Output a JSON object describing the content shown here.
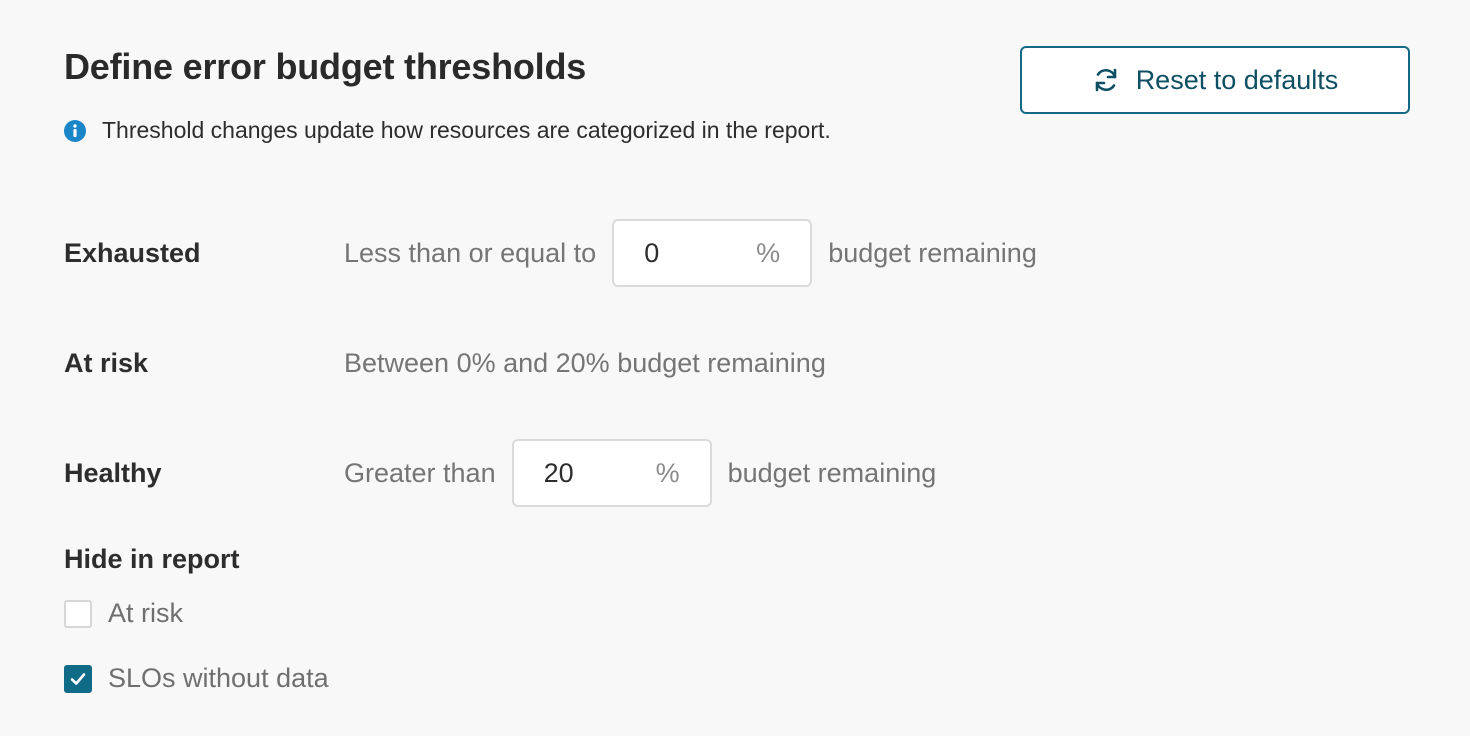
{
  "header": {
    "title": "Define error budget thresholds",
    "info_text": "Threshold changes update how resources are categorized in the report.",
    "reset_label": "Reset to defaults"
  },
  "thresholds": {
    "exhausted": {
      "label": "Exhausted",
      "prefix": "Less than or equal to",
      "value": "0",
      "unit": "%",
      "suffix": "budget remaining"
    },
    "at_risk": {
      "label": "At risk",
      "description": "Between 0% and 20% budget remaining"
    },
    "healthy": {
      "label": "Healthy",
      "prefix": "Greater than",
      "value": "20",
      "unit": "%",
      "suffix": "budget remaining"
    }
  },
  "hide_in_report": {
    "title": "Hide in report",
    "options": [
      {
        "label": "At risk",
        "checked": false
      },
      {
        "label": "SLOs without data",
        "checked": true
      }
    ]
  },
  "colors": {
    "accent": "#0f6b86",
    "info_icon": "#1a86c8",
    "button_border": "#146a85"
  }
}
